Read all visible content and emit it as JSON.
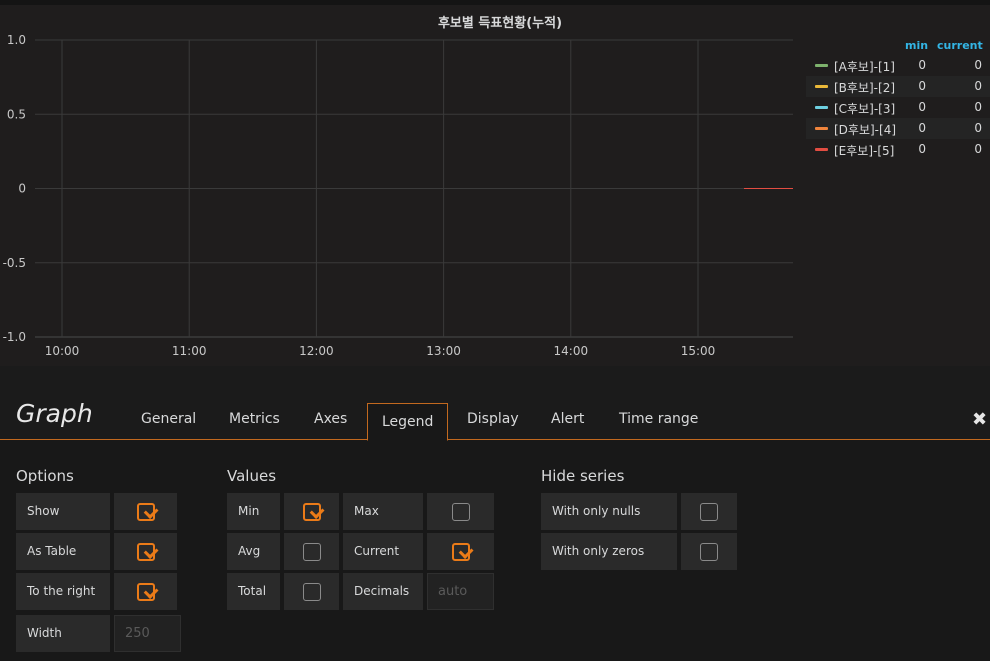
{
  "graph": {
    "title": "후보별 득표현황(누적)",
    "chart_data": {
      "type": "line",
      "y_ticks": [
        "1.0",
        "0.5",
        "0",
        "-0.5",
        "-1.0"
      ],
      "ylim": [
        -1.0,
        1.0
      ],
      "x_ticks": [
        "10:00",
        "11:00",
        "12:00",
        "13:00",
        "14:00",
        "15:00"
      ],
      "grid": true,
      "legend_placement": "right",
      "series": [
        {
          "name": "[A후보]-[1]",
          "color": "#7eb26d",
          "values": [
            0
          ]
        },
        {
          "name": "[B후보]-[2]",
          "color": "#eab839",
          "values": [
            0
          ]
        },
        {
          "name": "[C후보]-[3]",
          "color": "#6ed0e0",
          "values": [
            0
          ]
        },
        {
          "name": "[D후보]-[4]",
          "color": "#ef843c",
          "values": [
            0
          ]
        },
        {
          "name": "[E후보]-[5]",
          "color": "#e24d42",
          "values": [
            0
          ]
        }
      ]
    },
    "legend": {
      "col_min": "min",
      "col_current": "current",
      "rows": [
        {
          "name": "[A후보]-[1]",
          "min": "0",
          "current": "0"
        },
        {
          "name": "[B후보]-[2]",
          "min": "0",
          "current": "0"
        },
        {
          "name": "[C후보]-[3]",
          "min": "0",
          "current": "0"
        },
        {
          "name": "[D후보]-[4]",
          "min": "0",
          "current": "0"
        },
        {
          "name": "[E후보]-[5]",
          "min": "0",
          "current": "0"
        }
      ]
    }
  },
  "editor": {
    "title": "Graph",
    "tabs": [
      "General",
      "Metrics",
      "Axes",
      "Legend",
      "Display",
      "Alert",
      "Time range"
    ],
    "active_tab": "Legend",
    "close_icon": "close-icon",
    "accent_color": "#eb7b18",
    "options": {
      "title": "Options",
      "show": {
        "label": "Show",
        "checked": true
      },
      "as_table": {
        "label": "As Table",
        "checked": true
      },
      "to_the_right": {
        "label": "To the right",
        "checked": true
      },
      "width": {
        "label": "Width",
        "placeholder": "250"
      }
    },
    "values": {
      "title": "Values",
      "min": {
        "label": "Min",
        "checked": true
      },
      "max": {
        "label": "Max",
        "checked": false
      },
      "avg": {
        "label": "Avg",
        "checked": false
      },
      "current": {
        "label": "Current",
        "checked": true
      },
      "total": {
        "label": "Total",
        "checked": false
      },
      "decimals": {
        "label": "Decimals",
        "placeholder": "auto"
      }
    },
    "hide_series": {
      "title": "Hide series",
      "with_only_nulls": {
        "label": "With only nulls",
        "checked": false
      },
      "with_only_zeros": {
        "label": "With only zeros",
        "checked": false
      }
    }
  }
}
